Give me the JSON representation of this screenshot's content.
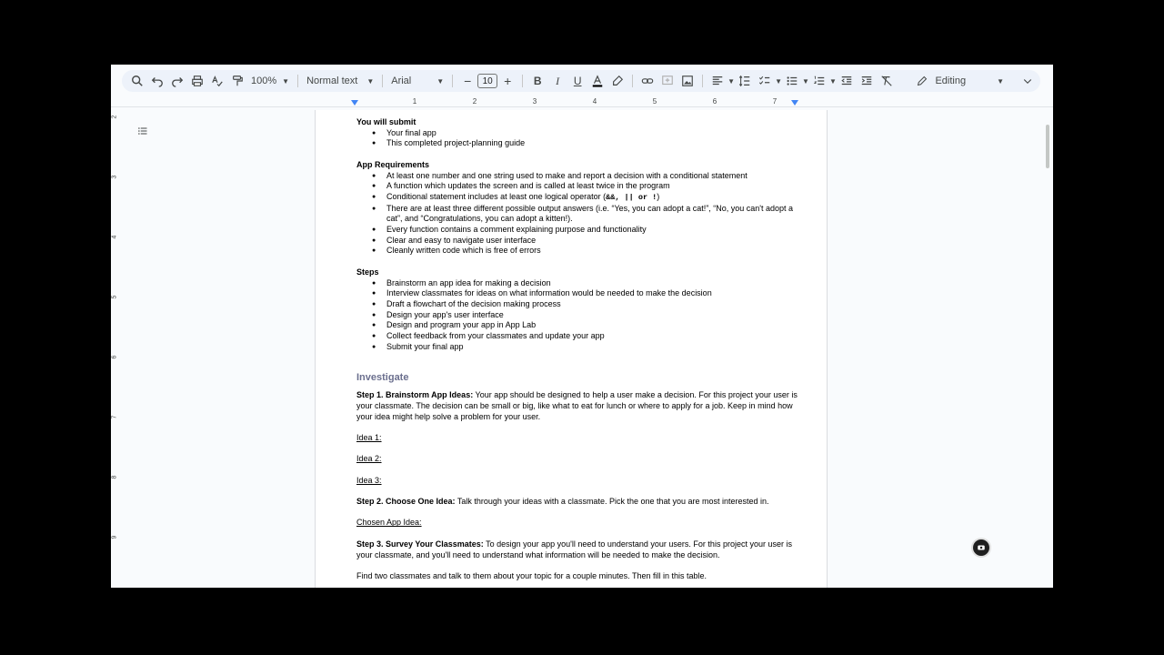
{
  "toolbar": {
    "zoom": "100%",
    "style": "Normal text",
    "font": "Arial",
    "font_size": "10",
    "mode": "Editing"
  },
  "ruler": {
    "ticks": [
      "1",
      "2",
      "3",
      "4",
      "5",
      "6",
      "7"
    ]
  },
  "vruler": {
    "ticks": [
      "2",
      "3",
      "4",
      "5",
      "6",
      "7",
      "8",
      "9"
    ]
  },
  "doc": {
    "submit_heading": "You will submit",
    "submit_items": [
      "Your final app",
      "This completed project-planning guide"
    ],
    "req_heading": "App Requirements",
    "req_items": [
      "At least one number and one string used to make and report a decision with a conditional statement",
      "A function which updates the screen and is called at least twice in the program",
      "Conditional statement includes at least one logical operator (",
      "There are at least three different possible output answers (i.e. “Yes, you can adopt a cat!”, “No, you can't adopt a cat”, and “Congratulations, you can adopt a kitten!).",
      "Every function contains a comment explaining purpose and functionality",
      "Clear and easy to navigate user interface",
      "Cleanly written code which is free of errors"
    ],
    "req_ops": "&&, || or !",
    "req_close": ")",
    "steps_heading": "Steps",
    "steps_items": [
      "Brainstorm an app idea for making a decision",
      "Interview classmates for ideas on what information would be needed to make the decision",
      "Draft a flowchart of the decision making process",
      "Design your app's user interface",
      "Design and program your app in App Lab",
      "Collect feedback from your classmates and update your app",
      "Submit your final app"
    ],
    "investigate": "Investigate",
    "step1_label": "Step 1. Brainstorm App Ideas:",
    "step1_text": " Your app should be designed to help a user make a decision. For this project your user is your classmate. The decision can be small or big, like what to eat for lunch or where to apply for a job. Keep in mind how your idea might help solve a problem for your user.",
    "idea1": "Idea 1:",
    "idea2": "Idea 2:",
    "idea3": "Idea 3:",
    "step2_label": "Step 2. Choose One Idea:",
    "step2_text": " Talk through your ideas with a classmate. Pick the one that you are most interested in.",
    "chosen": "Chosen App Idea:",
    "step3_label": "Step 3. Survey Your Classmates:",
    "step3_text": " To design your app you'll need to understand your users. For this project your user is your classmate, and you'll need to understand what information will be needed to make the decision.",
    "find_text": "Find two classmates and talk to them about your topic for a couple minutes. Then fill in this table."
  }
}
